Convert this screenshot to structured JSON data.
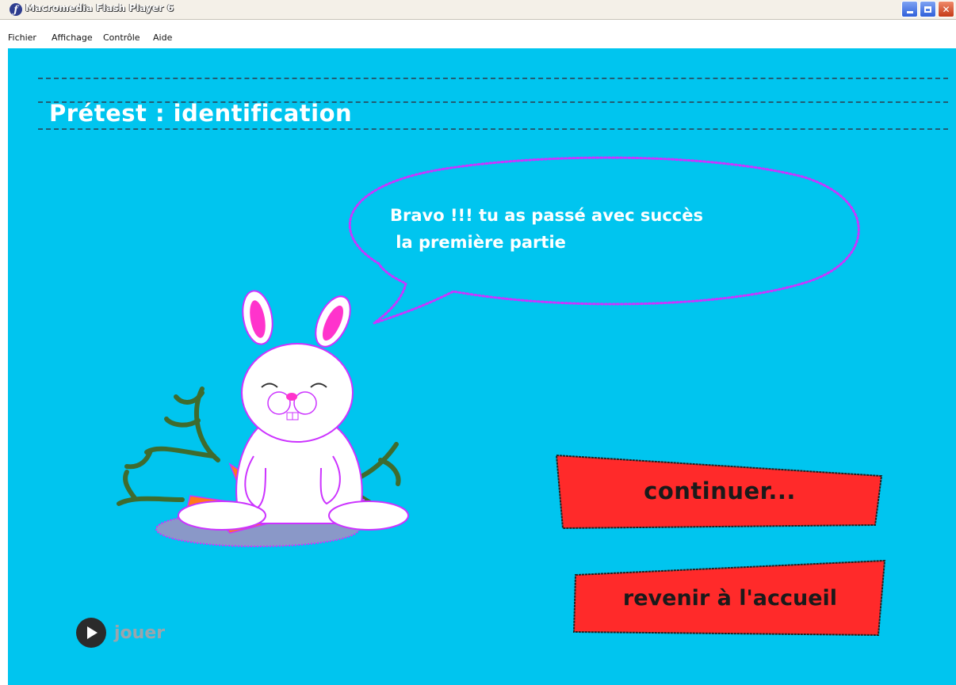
{
  "window": {
    "title": "Macromedia Flash Player 6"
  },
  "menu": {
    "items": [
      "Fichier",
      "Affichage",
      "Contrôle",
      "Aide"
    ]
  },
  "stage": {
    "background_color": "#00c5ef",
    "title": "Prétest : identification",
    "speech": {
      "line1": "Bravo !!! tu as passé avec succès",
      "line2": " la première partie",
      "outline_color": "#cc33ff"
    },
    "buttons": {
      "continue_label": "continuer...",
      "home_label": "revenir à l'accueil",
      "fill_color": "#ff2a2a"
    },
    "play": {
      "label": "jouer",
      "icon": "play-icon"
    },
    "illustration": "bunny-with-carrots"
  }
}
